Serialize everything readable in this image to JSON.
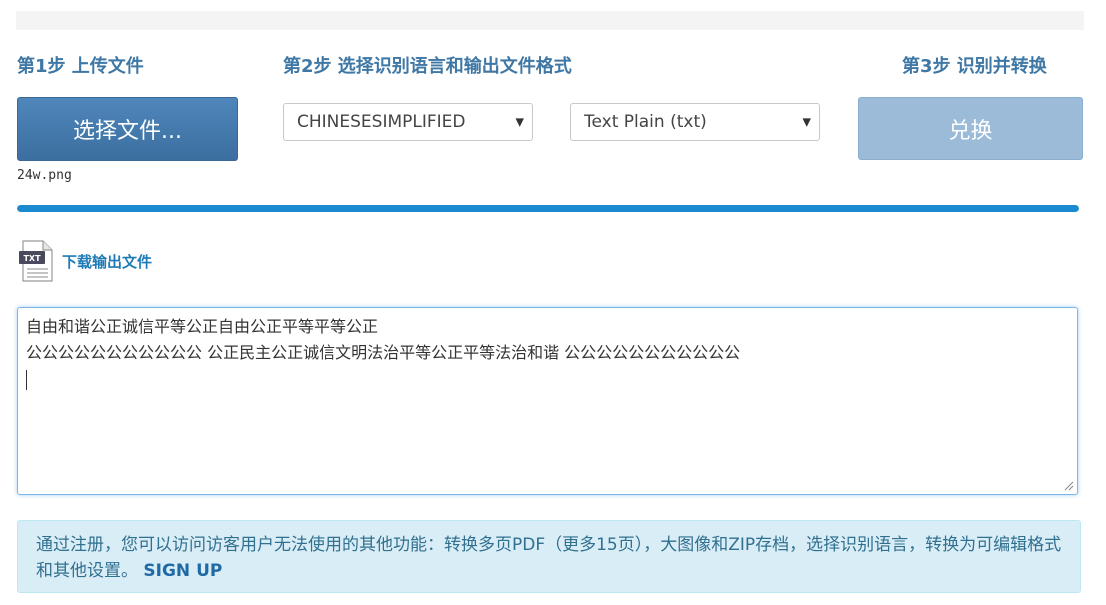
{
  "steps": {
    "step1": "第1步 上传文件",
    "step2": "第2步 选择识别语言和输出文件格式",
    "step3": "第3步 识别并转换"
  },
  "upload": {
    "button_label": "选择文件...",
    "file_name": "24w.png"
  },
  "language_select": {
    "selected": "CHINESESIMPLIFIED"
  },
  "format_select": {
    "selected": "Text Plain (txt)"
  },
  "convert": {
    "button_label": "兑换"
  },
  "progress": {
    "percent": 100,
    "color": "#1b8ad0"
  },
  "download": {
    "icon": "txt-file-icon",
    "icon_text": "TXT",
    "link_label": "下载输出文件"
  },
  "output": {
    "line1": "自由和谐公正诚信平等公正自由公正平等平等公正",
    "line2": "公公公公公公公公公公公 公正民主公正诚信文明法治平等公正平等法治和谐 公公公公公公公公公公公"
  },
  "info": {
    "text": "通过注册，您可以访问访客用户无法使用的其他功能：转换多页PDF（更多15页），大图像和ZIP存档，选择识别语言，转换为可编辑格式和其他设置。",
    "signup_label": "SIGN UP"
  },
  "colors": {
    "step_label": "#3f77a5",
    "primary_button": "#4a80b4",
    "disabled_button": "#9bbbd9",
    "info_background": "#d9edf7",
    "info_text": "#31708f"
  }
}
